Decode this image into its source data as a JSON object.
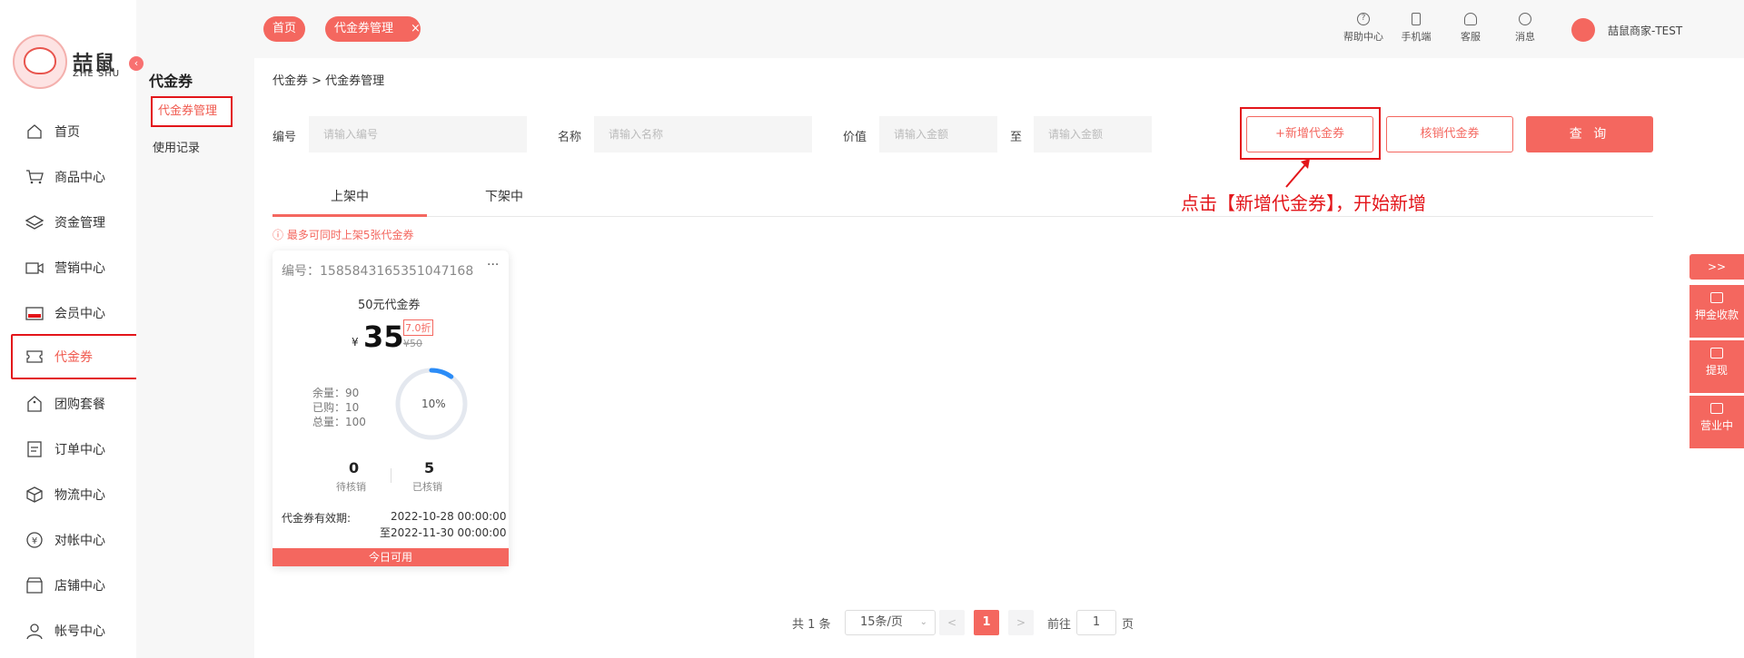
{
  "logo": {
    "text": "喆鼠",
    "sub": "ZHE SHU"
  },
  "nav": [
    {
      "label": "首页",
      "icon": "home-icon"
    },
    {
      "label": "商品中心",
      "icon": "cart-icon"
    },
    {
      "label": "资金管理",
      "icon": "layers-icon"
    },
    {
      "label": "营销中心",
      "icon": "video-icon"
    },
    {
      "label": "会员中心",
      "icon": "vip-card-icon"
    },
    {
      "label": "代金券",
      "icon": "ticket-icon"
    },
    {
      "label": "团购套餐",
      "icon": "tag-icon"
    },
    {
      "label": "订单中心",
      "icon": "order-icon"
    },
    {
      "label": "物流中心",
      "icon": "box-icon"
    },
    {
      "label": "对帐中心",
      "icon": "yen-icon"
    },
    {
      "label": "店铺中心",
      "icon": "shop-icon"
    },
    {
      "label": "帐号中心",
      "icon": "user-icon"
    }
  ],
  "subnav": {
    "title": "代金券",
    "items": [
      "代金券管理",
      "使用记录"
    ]
  },
  "tabs_top": [
    "首页",
    "代金券管理"
  ],
  "tools": [
    "帮助中心",
    "手机端",
    "客服",
    "消息"
  ],
  "user": {
    "name": "喆鼠商家-TEST"
  },
  "breadcrumb": "代金券  > 代金券管理",
  "filters": {
    "code_label": "编号",
    "code_placeholder": "请输入编号",
    "name_label": "名称",
    "name_placeholder": "请输入名称",
    "value_label": "价值",
    "min_placeholder": "请输入金额",
    "to": "至",
    "max_placeholder": "请输入金额"
  },
  "buttons": {
    "add": "+新增代金券",
    "verify": "核销代金券",
    "search": "查 询"
  },
  "annotation": "点击【新增代金券】，开始新增",
  "status_tabs": [
    "上架中",
    "下架中"
  ],
  "notice": "最多可同时上架5张代金券",
  "coupon": {
    "no": "编号：1585843165351047168",
    "more": "···",
    "name": "50元代金券",
    "yen": "¥",
    "price": "35",
    "discount": "7.0折",
    "original": "¥50",
    "remain": "余量：90",
    "bought": "已购：10",
    "total": "总量：100",
    "percent": "10%",
    "percent_value": 0.1,
    "pending_num": "0",
    "pending_label": "待核销",
    "used_num": "5",
    "used_label": "已核销",
    "valid_label": "代金券有效期:",
    "valid_from": "2022-10-28 00:00:00",
    "valid_to": "至2022-11-30 00:00:00",
    "footer": "今日可用"
  },
  "pagination": {
    "total": "共 1 条",
    "size": "15条/页",
    "current": "1",
    "goto": "前往",
    "page_input": "1",
    "page_unit": "页",
    "prev": "<",
    "next": ">"
  },
  "float": {
    "expand": ">>",
    "items": [
      "押金收款",
      "提现",
      "营业中"
    ]
  },
  "colors": {
    "accent": "#f4675f",
    "highlight": "#e3151a"
  }
}
